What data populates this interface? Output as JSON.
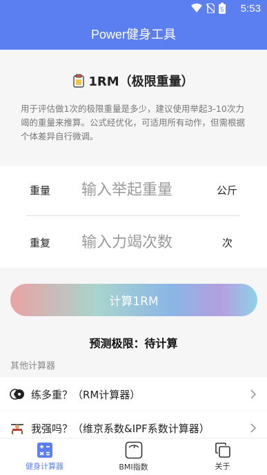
{
  "status_bar": {
    "time": "5:53",
    "battery_level": "5"
  },
  "app_bar": {
    "title": "Power健身工具"
  },
  "intro": {
    "icon": "clipboard-icon",
    "title": "1RM（极限重量）",
    "description": "用于评估做1次的极限重量是多少，建议使用举起3-10次力竭的重量来推算。公式经优化，可适用所有动作，但需根据个体差异自行微调。"
  },
  "form": {
    "weight": {
      "label": "重量",
      "placeholder": "输入举起重量",
      "unit": "公斤"
    },
    "reps": {
      "label": "重复",
      "placeholder": "输入力竭次数",
      "unit": "次"
    }
  },
  "calculate_button": {
    "label": "计算1RM"
  },
  "result": {
    "text": "预测极限：待计算"
  },
  "other_calculators": {
    "section_label": "其他计算器",
    "items": [
      {
        "label": "练多重？（RM计算器）",
        "icon": "weight-plate-icon"
      },
      {
        "label": "我强吗？（维京系数&IPF系数计算器）",
        "icon": "bench-press-icon"
      }
    ]
  },
  "tabs": [
    {
      "label": "健身计算器",
      "icon": "calculator-icon",
      "active": true
    },
    {
      "label": "BMI指数",
      "icon": "scale-icon",
      "active": false
    },
    {
      "label": "关于",
      "icon": "copy-icon",
      "active": false
    }
  ],
  "colors": {
    "primary": "#5b7ef0",
    "background": "#f6f6f6"
  }
}
